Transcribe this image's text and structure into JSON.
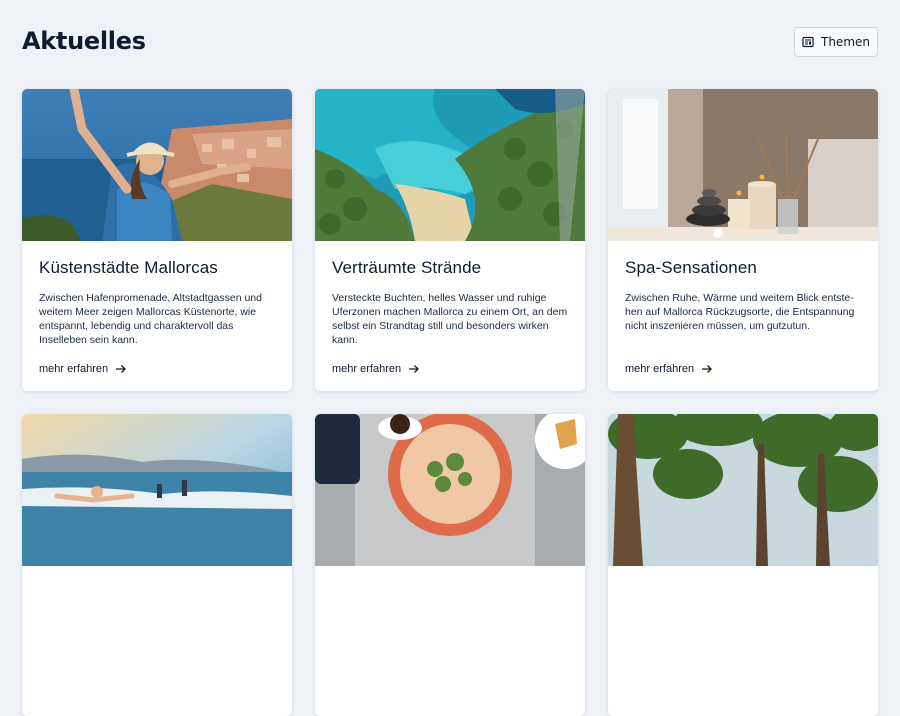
{
  "header": {
    "title": "Aktuelles",
    "themes_button": {
      "label": "Themen",
      "icon": "newspaper-icon"
    }
  },
  "cards": [
    {
      "title": "Küstenstädte Mallorcas",
      "text": "Zwischen Hafenpromenade, Altstadtgassen und weitem Meer zeigen Mallorcas Küstenorte, wie entspannt, lebendig und charaktervoll das Inselleben sein kann.",
      "link": "mehr erfahren",
      "image": "woman-coastal-town-photo"
    },
    {
      "title": "Verträumte Strände",
      "text": "Versteckte Buchten, helles Wasser und ruhige Uferzonen machen Mallorca zu einem Ort, an dem selbst ein Strandtag still und besonders wirken kann.",
      "link": "mehr erfahren",
      "image": "aerial-beach-cove-photo"
    },
    {
      "title": "Spa-Sensationen",
      "text": "Zwischen Ruhe, Wärme und weitem Blick entste­hen auf Mallorca Rückzugsorte, die Entspannung nicht inszenieren müssen, um gutzutun.",
      "link": "mehr erfahren",
      "image": "spa-candles-photo"
    },
    {
      "image": "beach-waves-photo"
    },
    {
      "image": "food-table-photo"
    },
    {
      "image": "pine-forest-photo"
    }
  ],
  "colors": {
    "background": "#eef2f7",
    "text": "#0f1b33",
    "card": "#ffffff"
  }
}
